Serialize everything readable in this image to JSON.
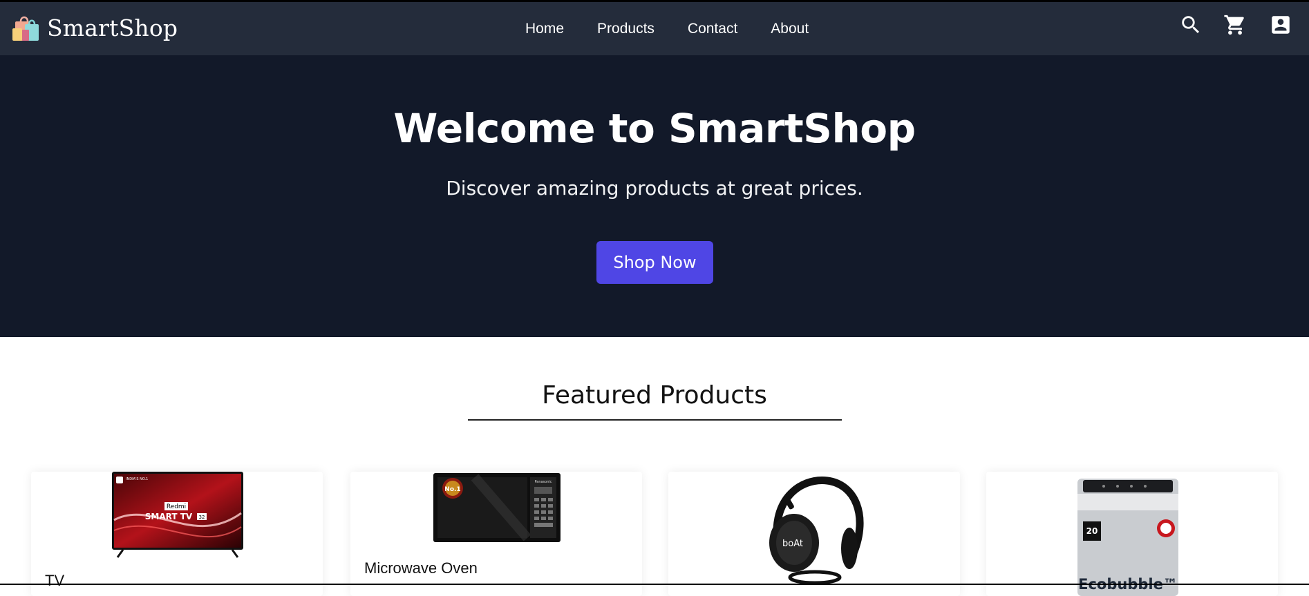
{
  "brand": {
    "name": "SmartShop",
    "logo_icon": "shopping-bags-icon"
  },
  "nav": {
    "links": [
      "Home",
      "Products",
      "Contact",
      "About"
    ],
    "icons": [
      "search-icon",
      "cart-icon",
      "account-icon"
    ]
  },
  "hero": {
    "title": "Welcome to SmartShop",
    "subtitle": "Discover amazing products at great prices.",
    "cta_label": "Shop Now"
  },
  "featured": {
    "title": "Featured Products",
    "products": [
      {
        "name": "TV",
        "image_text": [
          "INDIA'S NO.1",
          "Redmi",
          "SMART TV",
          "32"
        ]
      },
      {
        "name": "Microwave Oven",
        "image_text": [
          "No.1",
          "Panasonic"
        ]
      },
      {
        "name": "",
        "image_text": [
          "boAt"
        ]
      },
      {
        "name": "",
        "image_text": [
          "20",
          "Ecobubble™"
        ]
      }
    ]
  },
  "colors": {
    "navbar": "#242c3b",
    "hero": "#121929",
    "accent": "#4f46e5"
  }
}
